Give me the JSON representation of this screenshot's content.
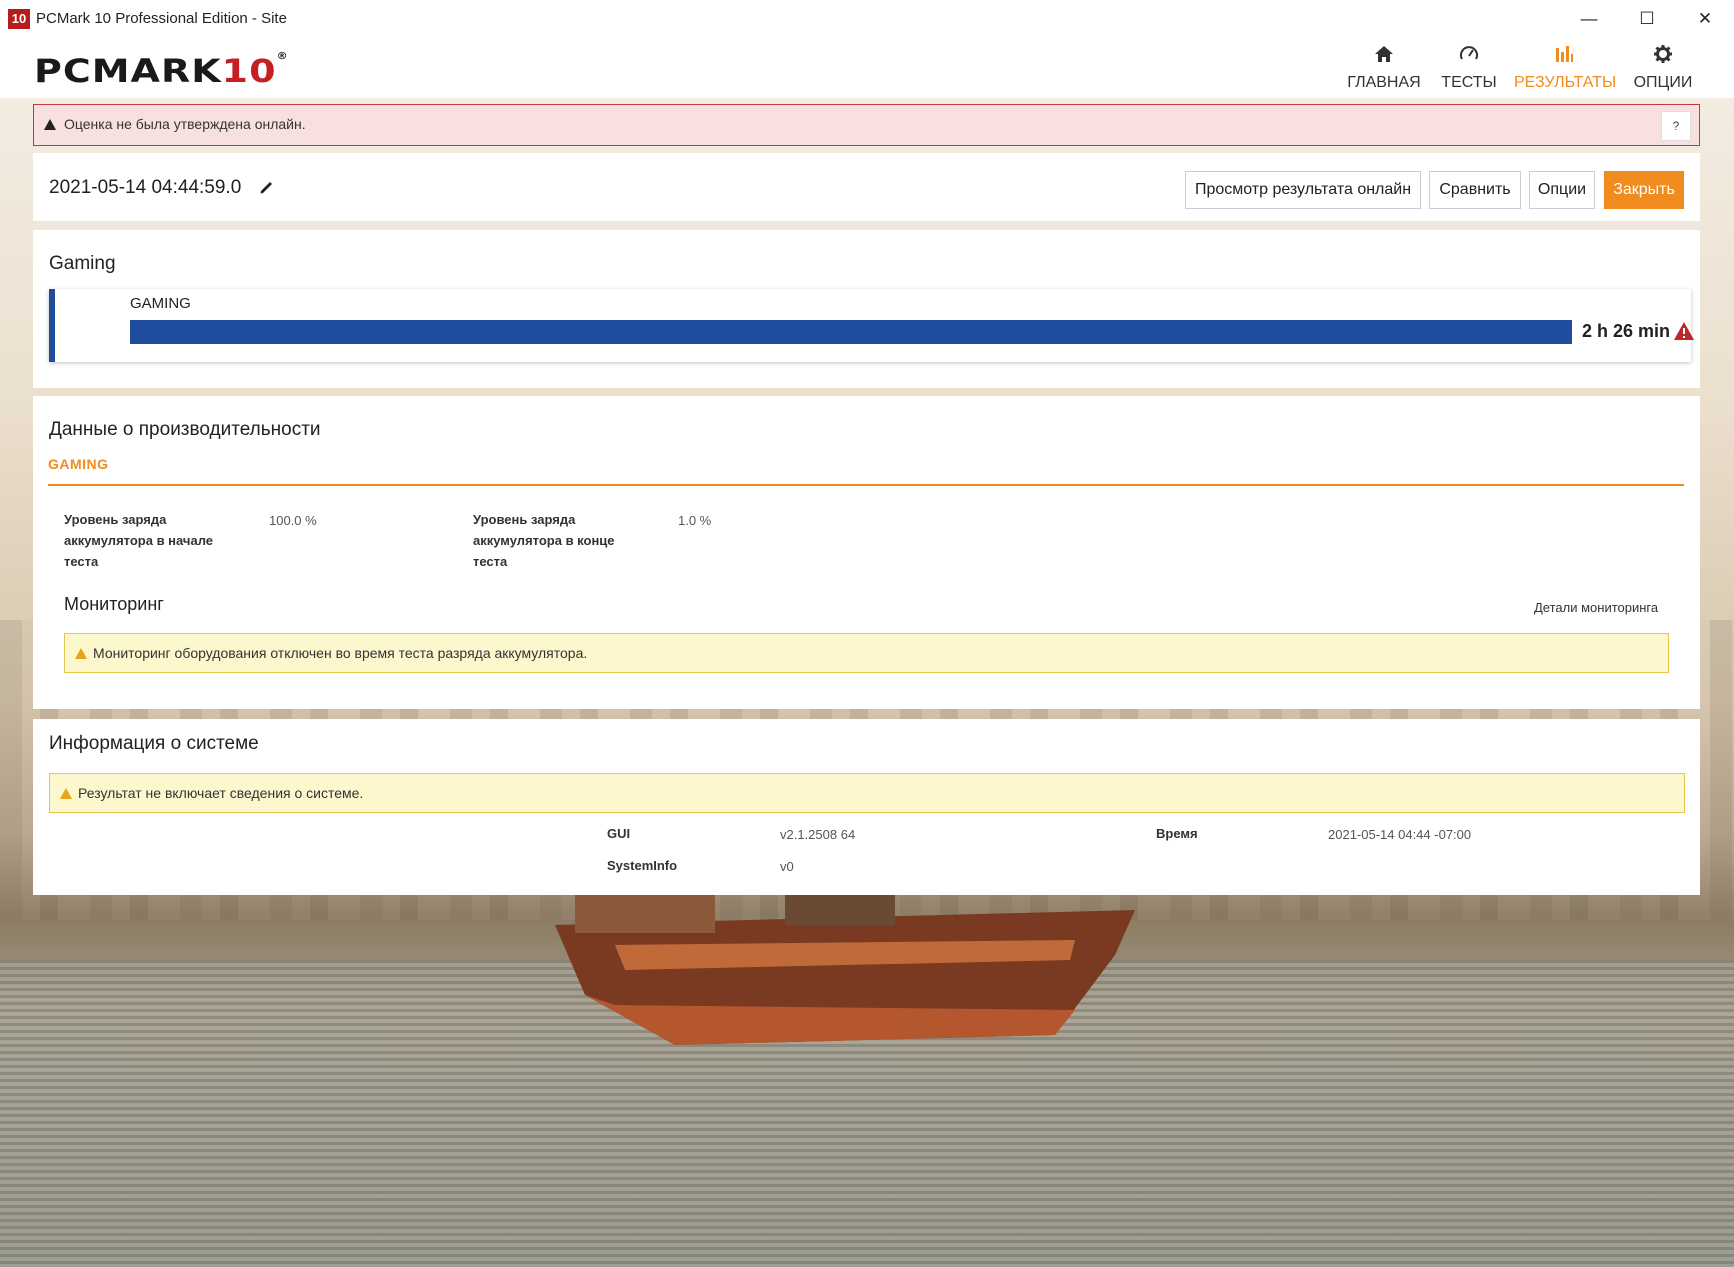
{
  "window": {
    "app_icon_text": "10",
    "title": "PCMark 10 Professional Edition - Site",
    "minimize": "—",
    "maximize": "☐",
    "close": "✕"
  },
  "header": {
    "logo_main": "PCMARK",
    "logo_num": "10",
    "logo_reg": "®",
    "nav": [
      {
        "label": "ГЛАВНАЯ",
        "icon": "home-icon"
      },
      {
        "label": "ТЕСТЫ",
        "icon": "gauge-icon"
      },
      {
        "label": "РЕЗУЛЬТАТЫ",
        "icon": "bar-chart-icon",
        "active": true
      },
      {
        "label": "ОПЦИИ",
        "icon": "gear-icon"
      }
    ],
    "accent_color": "#f08b1e"
  },
  "validation_alert": {
    "text": "Оценка не была утверждена онлайн.",
    "help": "?"
  },
  "result_bar": {
    "timestamp": "2021-05-14 04:44:59.0",
    "buttons": {
      "view_online": "Просмотр результата онлайн",
      "compare": "Сравнить",
      "options": "Опции",
      "close": "Закрыть"
    }
  },
  "score_section": {
    "title": "Gaming",
    "card_label": "GAMING",
    "score": "2 h 26 min",
    "bar_color": "#1f4c9c",
    "warning_color": "#b82a2a"
  },
  "performance": {
    "title": "Данные о производительности",
    "tab": "GAMING",
    "rows": [
      {
        "label": "Уровень заряда аккумулятора в начале теста",
        "value": "100.0 %"
      },
      {
        "label": "Уровень заряда аккумулятора в конце теста",
        "value": "1.0 %"
      }
    ],
    "monitoring_title": "Мониторинг",
    "monitoring_details": "Детали мониторинга",
    "monitoring_alert": "Мониторинг оборудования отключен во время теста разряда аккумулятора."
  },
  "system_info": {
    "title": "Информация о системе",
    "alert": "Результат не включает сведения о системе.",
    "fields": [
      {
        "label": "GUI",
        "value": "v2.1.2508 64"
      },
      {
        "label": "Время",
        "value": "2021-05-14 04:44 -07:00"
      },
      {
        "label": "SystemInfo",
        "value": "v0"
      }
    ]
  }
}
